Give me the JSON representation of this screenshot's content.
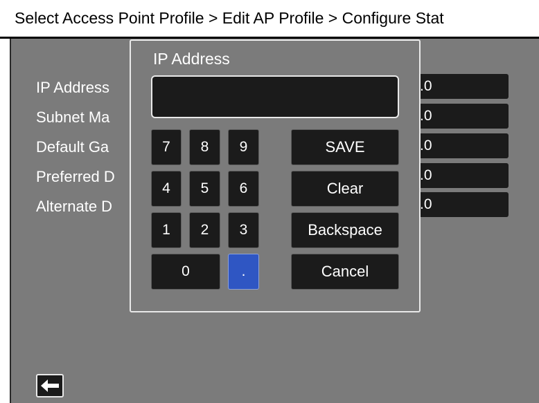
{
  "header": {
    "breadcrumb": "Select Access Point Profile > Edit AP Profile > Configure Stat"
  },
  "fields": [
    {
      "label": "IP Address",
      "value": ".0"
    },
    {
      "label": "Subnet Ma",
      "value": ".0"
    },
    {
      "label": "Default Ga",
      "value": ".0"
    },
    {
      "label": "Preferred D",
      "value": ".0"
    },
    {
      "label": "Alternate D",
      "value": ".0"
    }
  ],
  "dialog": {
    "title": "IP Address",
    "display_value": "",
    "keys": {
      "k7": "7",
      "k8": "8",
      "k9": "9",
      "k4": "4",
      "k5": "5",
      "k6": "6",
      "k1": "1",
      "k2": "2",
      "k3": "3",
      "k0": "0",
      "dot": "."
    },
    "actions": {
      "save": "SAVE",
      "clear": "Clear",
      "backspace": "Backspace",
      "cancel": "Cancel"
    }
  },
  "footer": {
    "back_icon": "left-arrow-icon"
  },
  "colors": {
    "background": "#7b7b7b",
    "key": "#1b1b1b",
    "dot_key": "#2f56c3",
    "border": "#e9e9e9"
  }
}
